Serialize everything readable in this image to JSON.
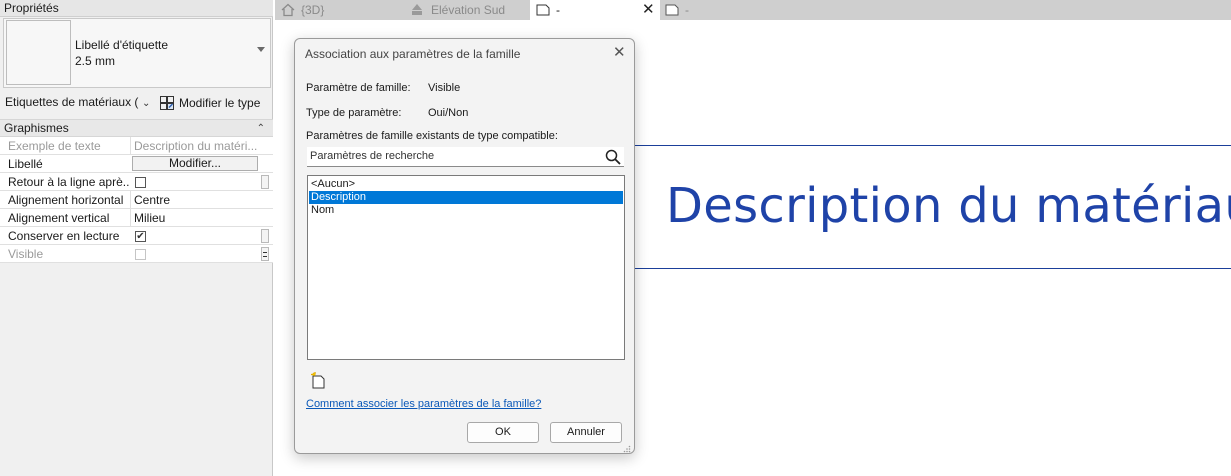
{
  "properties_panel": {
    "title": "Propriétés",
    "type_selector": {
      "name": "Libellé d'étiquette",
      "size": "2.5 mm"
    },
    "category_select": "Etiquettes de matériaux (",
    "edit_type_label": "Modifier le type",
    "group": "Graphismes",
    "rows": [
      {
        "name": "Exemple de texte",
        "value": "Description du matéri..."
      },
      {
        "name": "Libellé",
        "button": "Modifier..."
      },
      {
        "name": "Retour à la ligne aprè...",
        "checked": false
      },
      {
        "name": "Alignement horizontal",
        "value": "Centre"
      },
      {
        "name": "Alignement vertical",
        "value": "Milieu"
      },
      {
        "name": "Conserver en lecture",
        "checked": true
      },
      {
        "name": "Visible",
        "checked": false
      }
    ]
  },
  "tabs": [
    {
      "label": "{3D}",
      "icon": "home-icon"
    },
    {
      "label": "Elévation Sud",
      "icon": "elevation-icon"
    },
    {
      "label": "-",
      "icon": "sheet-icon",
      "active": true,
      "close": "✕"
    },
    {
      "label": "-",
      "icon": "sheet-icon"
    }
  ],
  "canvas": {
    "label_text": "Description du matériau",
    "line_color": "#1b3f9a",
    "text_color": "#1f43a8"
  },
  "dialog": {
    "title": "Association aux paramètres de la famille",
    "close": "✕",
    "family_param_label": "Paramètre de famille:",
    "family_param_value": "Visible",
    "param_type_label": "Type de paramètre:",
    "param_type_value": "Oui/Non",
    "existing_label": "Paramètres de famille existants de type compatible:",
    "search_placeholder": "Paramètres de recherche",
    "list_items": [
      "<Aucun>",
      "Description",
      "Nom"
    ],
    "selected_item": "Description",
    "help_link": "Comment associer les paramètres de la famille?",
    "ok": "OK",
    "cancel": "Annuler",
    "selection_color": "#0078d7"
  }
}
